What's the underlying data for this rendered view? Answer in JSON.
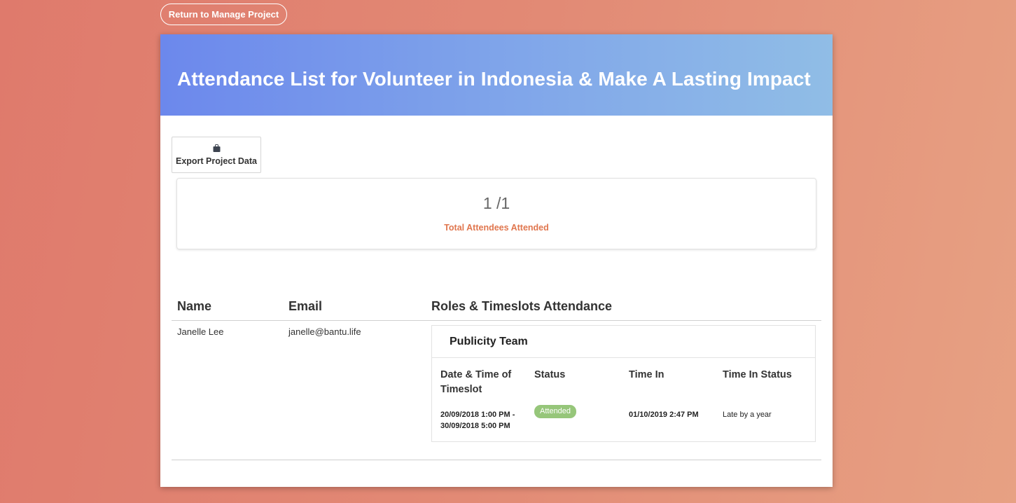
{
  "nav": {
    "return_label": "Return to Manage Project"
  },
  "header": {
    "title": "Attendance List for Volunteer in Indonesia & Make A Lasting Impact"
  },
  "toolbar": {
    "export_label": "Export Project Data",
    "export_icon": "bag-icon"
  },
  "stats": {
    "count": "1 /1",
    "label": "Total Attendees Attended"
  },
  "table": {
    "headers": {
      "name": "Name",
      "email": "Email",
      "roles": "Roles & Timeslots Attendance"
    },
    "rows": [
      {
        "name": "Janelle Lee",
        "email": "janelle@bantu.life",
        "role": {
          "title": "Publicity Team",
          "headers": [
            "Date & Time of Timeslot",
            "Status",
            "Time In",
            "Time In Status"
          ],
          "timeslot": {
            "date_line1": "20/09/2018 1:00 PM -",
            "date_line2": "30/09/2018 5:00 PM",
            "status": "Attended",
            "time_in": "01/10/2019 2:47 PM",
            "time_in_status": "Late by a year"
          }
        }
      }
    ]
  },
  "colors": {
    "accent_orange": "#e0764e",
    "badge_green": "#96c67a",
    "banner_start": "#6c88ec",
    "banner_end": "#90bde6"
  }
}
